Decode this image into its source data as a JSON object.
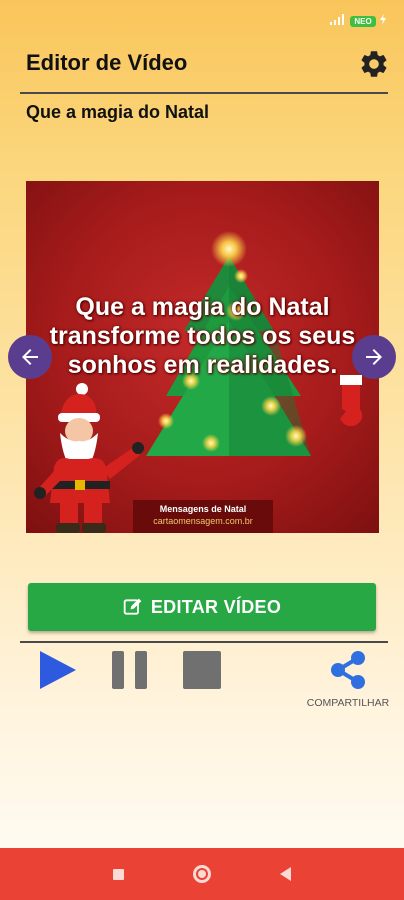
{
  "status": {
    "battery_label": "NEO"
  },
  "app_bar": {
    "title": "Editor de Vídeo"
  },
  "video": {
    "title": "Que a magia do Natal",
    "preview_lines": [
      "Que a magia do Natal",
      "transforme todos os seus",
      "sonhos em realidades."
    ],
    "signature_title": "Mensagens de Natal",
    "signature_site": "cartaomensagem.com.br"
  },
  "actions": {
    "edit_label": "EDITAR VÍDEO",
    "share_label": "COMPARTILHAR"
  },
  "colors": {
    "accent_green": "#27a844",
    "nav_arrow": "#5b3d8f",
    "play_blue": "#2e5ae0",
    "share_blue": "#2f6fe0",
    "bottom_nav": "#ea4335"
  }
}
